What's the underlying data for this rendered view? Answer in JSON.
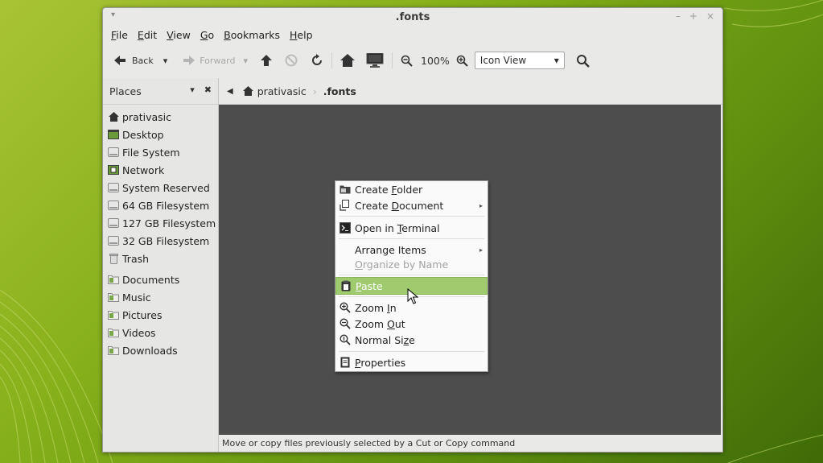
{
  "window": {
    "title": ".fonts",
    "controls": {
      "minimize": "–",
      "maximize": "+",
      "close": "×"
    },
    "menu_button": "▾"
  },
  "menubar": [
    {
      "mnemonic": "F",
      "rest": "ile"
    },
    {
      "mnemonic": "E",
      "rest": "dit"
    },
    {
      "mnemonic": "V",
      "rest": "iew"
    },
    {
      "mnemonic": "G",
      "rest": "o"
    },
    {
      "mnemonic": "B",
      "rest": "ookmarks"
    },
    {
      "mnemonic": "H",
      "rest": "elp"
    }
  ],
  "toolbar": {
    "back_label": "Back",
    "forward_label": "Forward",
    "dropdown_glyph": "▾",
    "zoom_level": "100%",
    "view_mode": "Icon View"
  },
  "sidebar": {
    "title": "Places",
    "toggle_glyph": "▾",
    "close_glyph": "✖",
    "items": [
      {
        "label": "prativasic",
        "icon": "home-icon"
      },
      {
        "label": "Desktop",
        "icon": "desktop-icon"
      },
      {
        "label": "File System",
        "icon": "drive-icon"
      },
      {
        "label": "Network",
        "icon": "network-icon"
      },
      {
        "label": "System Reserved",
        "icon": "drive-icon"
      },
      {
        "label": "64 GB Filesystem",
        "icon": "drive-icon"
      },
      {
        "label": "127 GB Filesystem",
        "icon": "drive-icon"
      },
      {
        "label": "32 GB Filesystem",
        "icon": "drive-icon"
      },
      {
        "label": "Trash",
        "icon": "trash-icon"
      },
      {
        "label": "Documents",
        "icon": "folder-documents-icon"
      },
      {
        "label": "Music",
        "icon": "folder-music-icon"
      },
      {
        "label": "Pictures",
        "icon": "folder-pictures-icon"
      },
      {
        "label": "Videos",
        "icon": "folder-videos-icon"
      },
      {
        "label": "Downloads",
        "icon": "folder-downloads-icon"
      }
    ]
  },
  "pathbar": {
    "back_arrow": "◀",
    "crumbs": [
      "prativasic",
      ".fonts"
    ],
    "separator": "›"
  },
  "status_text": "Move or copy files previously selected by a Cut or Copy command",
  "context_menu": {
    "items": [
      {
        "pre": "Create ",
        "mn": "F",
        "post": "older",
        "icon": "folder-new-icon"
      },
      {
        "pre": "Create ",
        "mn": "D",
        "post": "ocument",
        "icon": "document-new-icon",
        "submenu": "▸"
      },
      {
        "pre": "Open in ",
        "mn": "T",
        "post": "erminal",
        "icon": "terminal-icon"
      },
      {
        "pre": "Arrange Items",
        "mn": "",
        "post": "",
        "icon": "",
        "submenu": "▸"
      },
      {
        "pre": "",
        "mn": "O",
        "post": "rganize by Name",
        "icon": "",
        "disabled": true
      },
      {
        "pre": "",
        "mn": "P",
        "post": "aste",
        "icon": "paste-icon",
        "active": true
      },
      {
        "pre": "Zoom ",
        "mn": "I",
        "post": "n",
        "icon": "zoom-in-icon"
      },
      {
        "pre": "Zoom ",
        "mn": "O",
        "post": "ut",
        "icon": "zoom-out-icon"
      },
      {
        "pre": "Normal Si",
        "mn": "z",
        "post": "e",
        "icon": "zoom-original-icon"
      },
      {
        "pre": "",
        "mn": "P",
        "post": "roperties",
        "icon": "properties-icon"
      }
    ]
  },
  "colors": {
    "accent": "#9fca6d",
    "content_bg": "#4d4d4d",
    "wallpaper": "#6c9a12"
  }
}
